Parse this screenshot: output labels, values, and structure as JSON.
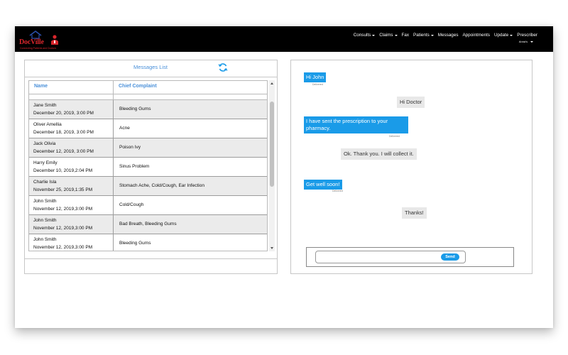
{
  "brand": {
    "name": "DocVille",
    "tagline": "Connecting Patients and Doctors",
    "color": "#d9262c"
  },
  "nav": {
    "items": [
      {
        "label": "Consults",
        "dropdown": true
      },
      {
        "label": "Claims",
        "dropdown": true
      },
      {
        "label": "Fax",
        "dropdown": false
      },
      {
        "label": "Patients",
        "dropdown": true
      },
      {
        "label": "Messages",
        "dropdown": false
      },
      {
        "label": "Appointments",
        "dropdown": false
      },
      {
        "label": "Update",
        "dropdown": true
      },
      {
        "label": "Prescriber",
        "dropdown": false
      }
    ],
    "user_label": "Anna's"
  },
  "messages_list": {
    "title": "Messages List",
    "columns": [
      "Name",
      "Chief Complaint"
    ],
    "rows": [
      {
        "name": "Jane Smith",
        "date": "December 20, 2019, 3:00 PM",
        "complaint": "Bleeding Gums"
      },
      {
        "name": "Oliver Amellia",
        "date": "December 18, 2019, 3:00 PM",
        "complaint": "Acne"
      },
      {
        "name": "Jack Olivia",
        "date": "December 12, 2019, 3:00 PM",
        "complaint": "Poison Ivy"
      },
      {
        "name": "Harry Emily",
        "date": "December 10, 2019,2:04 PM",
        "complaint": "Sinus Problem"
      },
      {
        "name": "Charlie Isla",
        "date": "November 25, 2019,1:35 PM",
        "complaint": "Stomach Ache, Cold/Cough, Ear Infection"
      },
      {
        "name": "John Smith",
        "date": "November 12, 2019,3:00 PM",
        "complaint": "Cold/Cough"
      },
      {
        "name": "John Smith",
        "date": "November 12, 2019,3:00 PM",
        "complaint": "Bad Breath, Bleeding Gums"
      },
      {
        "name": "John Smith",
        "date": "November 12, 2019,3:00 PM",
        "complaint": "Bleeding Gums"
      }
    ]
  },
  "chat": {
    "delivered_label": "Delivered",
    "messages": [
      {
        "from": "doctor",
        "text": "Hi John",
        "delivered": true
      },
      {
        "from": "patient",
        "text": "Hi Doctor",
        "delivered": false
      },
      {
        "from": "doctor",
        "text": "I have sent the prescription to your pharmacy.",
        "delivered": true
      },
      {
        "from": "patient",
        "text": "Ok. Thank you. I will collect it.",
        "delivered": false
      },
      {
        "from": "doctor",
        "text": "Get well soon!",
        "delivered": true
      },
      {
        "from": "patient",
        "text": "Thanks!",
        "delivered": false
      }
    ],
    "input_value": "",
    "send_label": "Send"
  },
  "colors": {
    "accent": "#1a9be8",
    "header_text": "#4a90d9",
    "navbar": "#000000"
  }
}
